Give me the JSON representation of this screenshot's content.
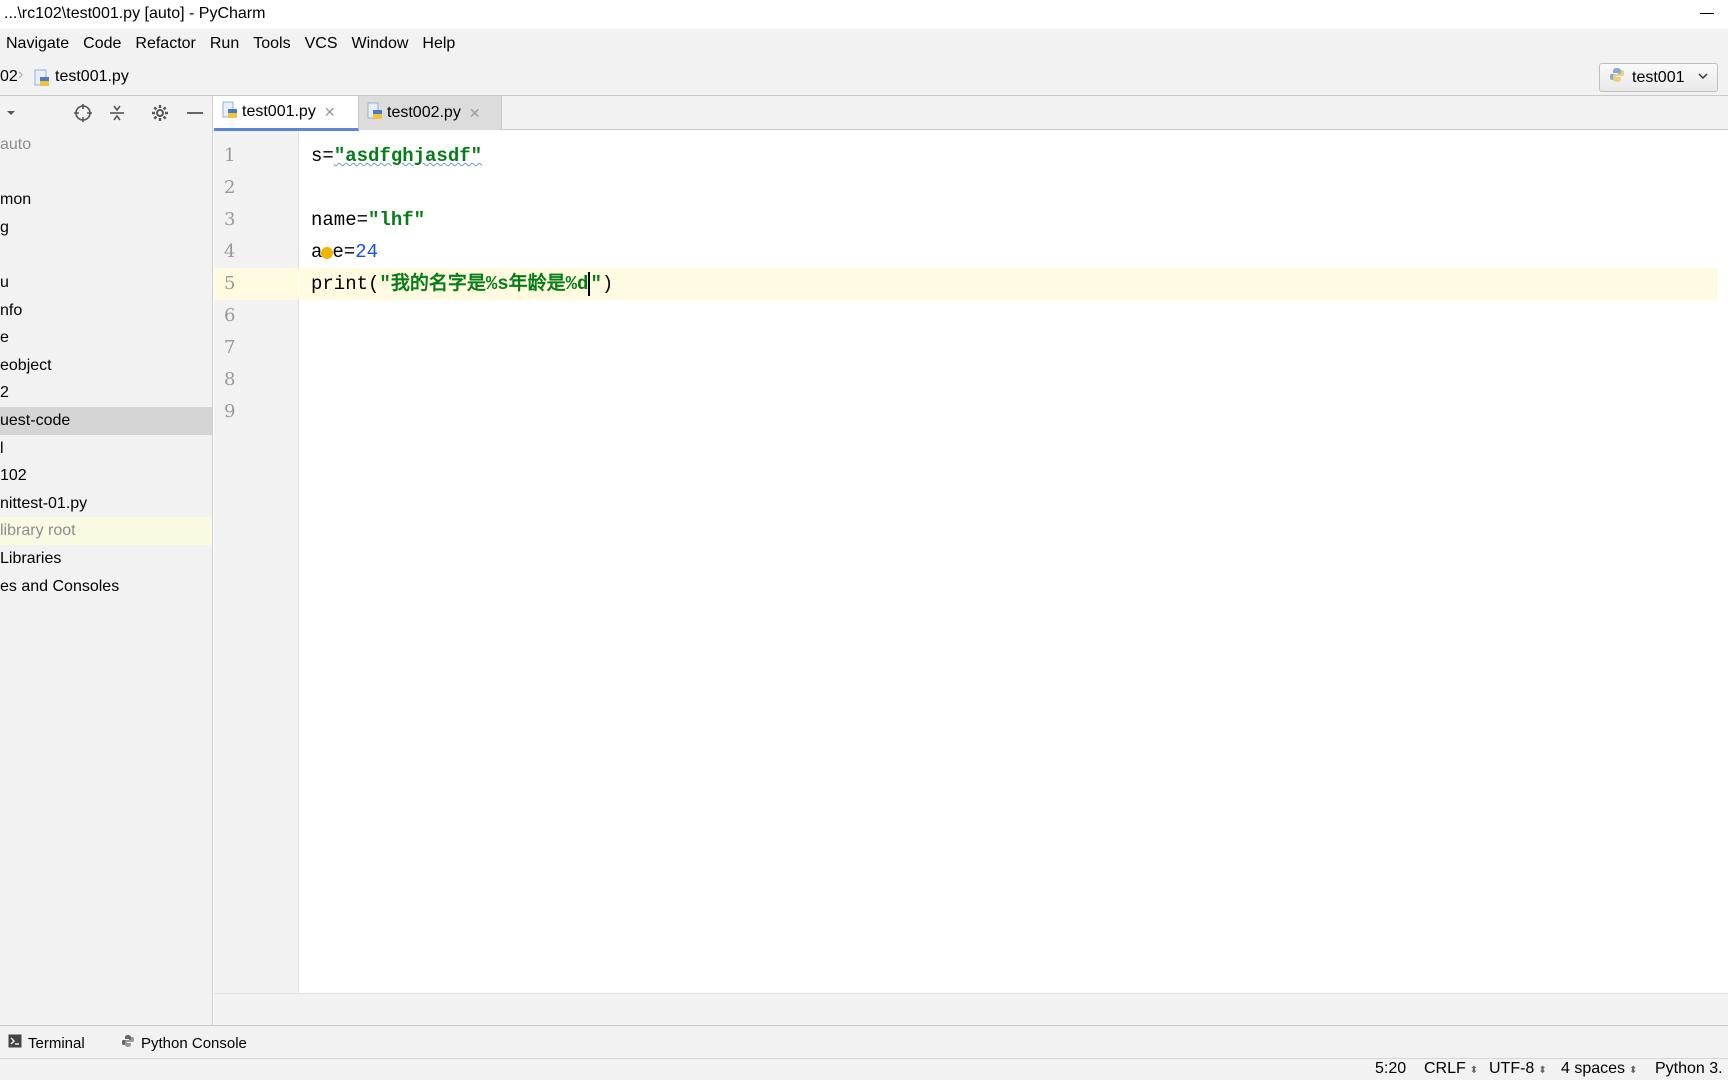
{
  "window": {
    "title": "...\\rc102\\test001.py [auto] - PyCharm"
  },
  "menu": [
    "Navigate",
    "Code",
    "Refactor",
    "Run",
    "Tools",
    "VCS",
    "Window",
    "Help"
  ],
  "breadcrumb": {
    "prev": "02",
    "file": "test001.py"
  },
  "run_config": {
    "label": "test001"
  },
  "project_tree": [
    {
      "label": "auto",
      "style": "dim"
    },
    {
      "label": "",
      "style": ""
    },
    {
      "label": "mon",
      "style": ""
    },
    {
      "label": "g",
      "style": ""
    },
    {
      "label": "",
      "style": ""
    },
    {
      "label": "u",
      "style": ""
    },
    {
      "label": "nfo",
      "style": ""
    },
    {
      "label": "e",
      "style": ""
    },
    {
      "label": "eobject",
      "style": ""
    },
    {
      "label": "2",
      "style": ""
    },
    {
      "label": "uest-code",
      "style": "selected"
    },
    {
      "label": "l",
      "style": ""
    },
    {
      "label": "102",
      "style": ""
    },
    {
      "label": "nittest-01.py",
      "style": ""
    },
    {
      "label": " library root",
      "style": "highlight dim"
    },
    {
      "label": " Libraries",
      "style": ""
    },
    {
      "label": "es and Consoles",
      "style": ""
    }
  ],
  "tabs": [
    {
      "label": "test001.py",
      "active": true
    },
    {
      "label": "test002.py",
      "active": false
    }
  ],
  "editor": {
    "line_numbers": [
      "1",
      "2",
      "3",
      "4",
      "5",
      "6",
      "7",
      "8",
      "9"
    ],
    "current_line": 5,
    "code": {
      "l1_var": "s=",
      "l1_str": "\"asdfghjasdf\"",
      "l3_var": "name=",
      "l3_str": "\"lhf\"",
      "l4_a": "a",
      "l4_rest": "e=",
      "l4_num": "24",
      "l5_func": "print(",
      "l5_str": "\"我的名字是%s年龄是%d",
      "l5_end_quote": "\"",
      "l5_close": ")"
    }
  },
  "tool_windows": [
    "Terminal",
    "Python Console"
  ],
  "status": {
    "position": "5:20",
    "line_sep": "CRLF",
    "encoding": "UTF-8",
    "indent": "4 spaces",
    "interpreter": "Python 3."
  }
}
